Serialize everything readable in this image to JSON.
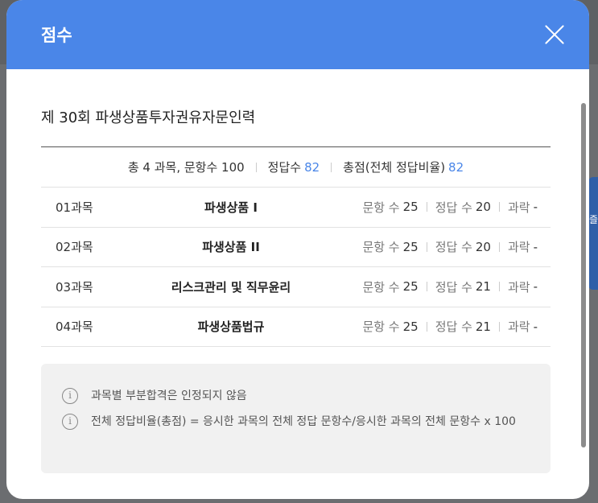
{
  "modal": {
    "title": "점수",
    "exam_title": "제 30회 파생상품투자권유자문인력"
  },
  "summary": {
    "total_label": "총 4 과목, 문항수 100",
    "correct_label": "정답수",
    "correct_value": "82",
    "score_label": "총점(전체 정답비율)",
    "score_value": "82"
  },
  "subjects": [
    {
      "code": "01과목",
      "name": "파생상품 I",
      "q_label": "문항 수",
      "q": "25",
      "c_label": "정답 수",
      "c": "20",
      "f_label": "과락",
      "f": "-"
    },
    {
      "code": "02과목",
      "name": "파생상품 II",
      "q_label": "문항 수",
      "q": "25",
      "c_label": "정답 수",
      "c": "20",
      "f_label": "과락",
      "f": "-"
    },
    {
      "code": "03과목",
      "name": "리스크관리 및 직무윤리",
      "q_label": "문항 수",
      "q": "25",
      "c_label": "정답 수",
      "c": "21",
      "f_label": "과락",
      "f": "-"
    },
    {
      "code": "04과목",
      "name": "파생상품법규",
      "q_label": "문항 수",
      "q": "25",
      "c_label": "정답 수",
      "c": "21",
      "f_label": "과락",
      "f": "-"
    }
  ],
  "notices": [
    {
      "icon": "i",
      "text": "과목별 부분합격은 인정되지 않음"
    },
    {
      "icon": "i",
      "text": "전체 정답비율(총점) = 응시한 과목의 전체 정답 문항수/응시한 과목의 전체 문항수 x 100"
    }
  ],
  "colors": {
    "header": "#4a86e8",
    "accent": "#4a86e8"
  }
}
